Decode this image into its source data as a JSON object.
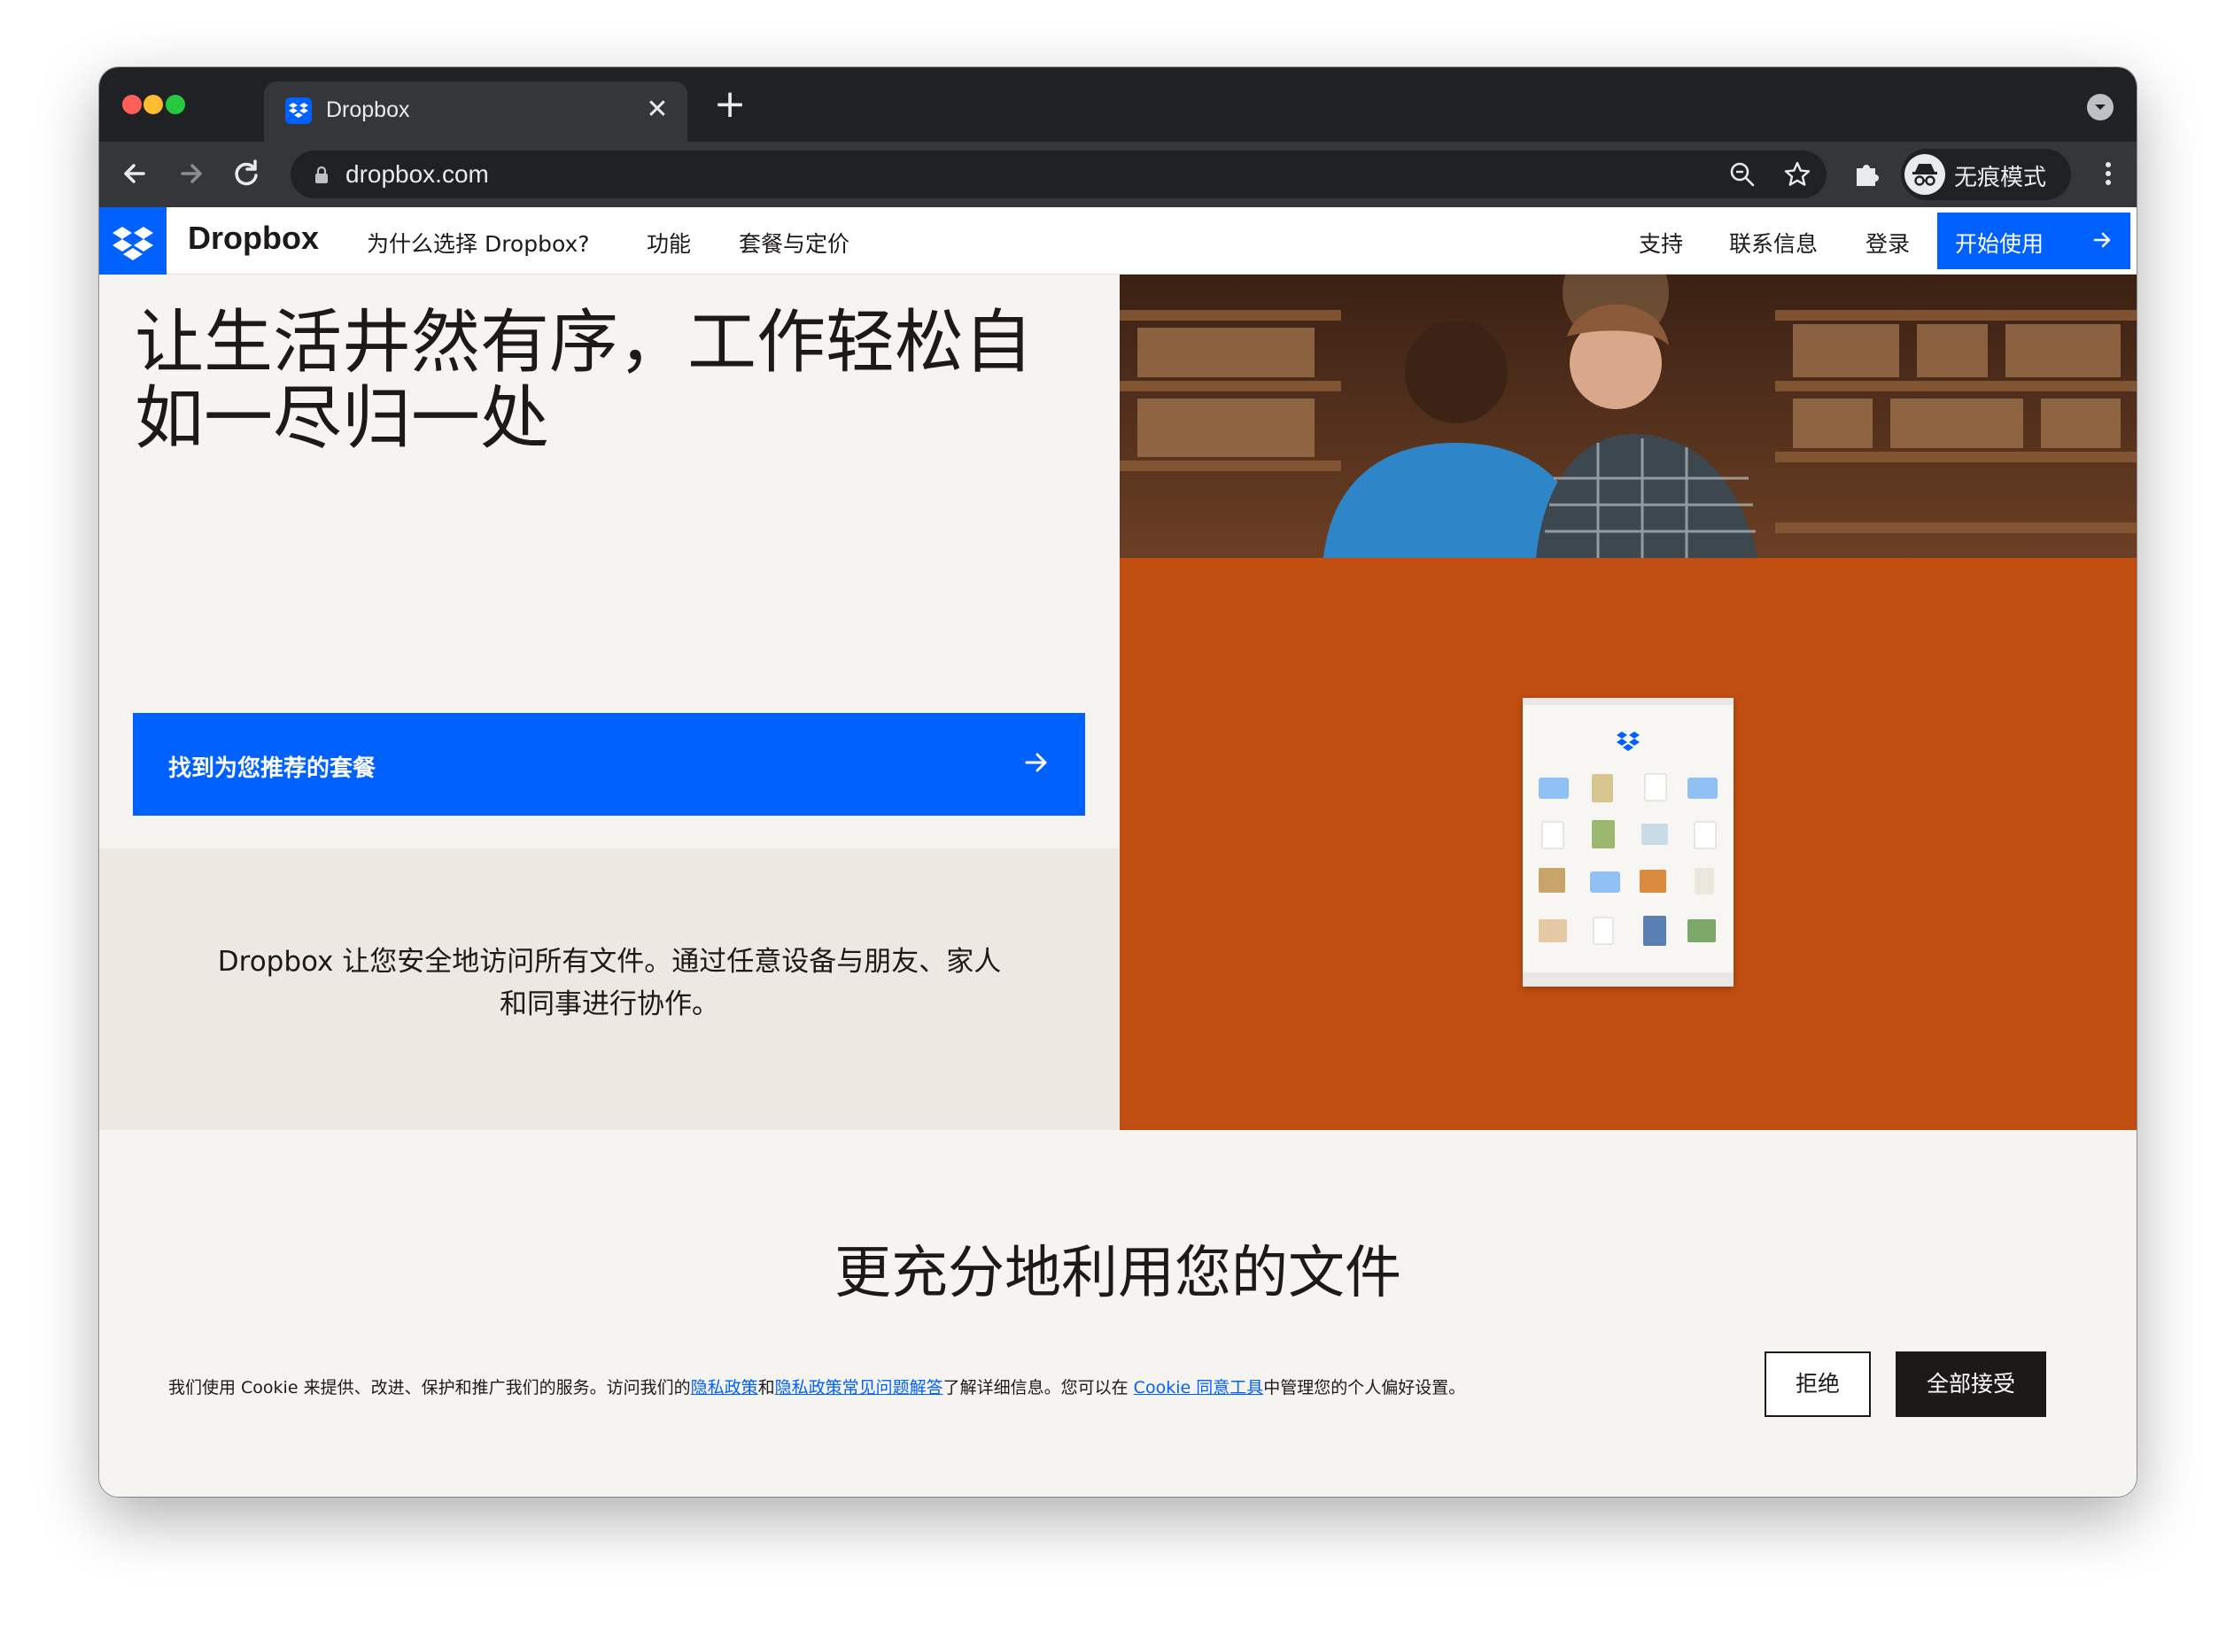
{
  "browser": {
    "tab_title": "Dropbox",
    "tab_close": "✕",
    "new_tab": "+",
    "url": "dropbox.com",
    "profile_label": "无痕模式"
  },
  "nav": {
    "brand": "Dropbox",
    "links": [
      "为什么选择 Dropbox?",
      "功能",
      "套餐与定价"
    ],
    "right_links": [
      "支持",
      "联系信息",
      "登录"
    ],
    "cta": "开始使用"
  },
  "hero": {
    "title": "让生活井然有序，工作轻松自如一尽归一处",
    "cta": "找到为您推荐的套餐",
    "subtitle": "Dropbox 让您安全地访问所有文件。通过任意设备与朋友、家人和同事进行协作。"
  },
  "section": {
    "heading": "更充分地利用您的文件"
  },
  "cookie": {
    "text_1": "我们使用 Cookie 来提供、改进、保护和推广我们的服务。访问我们的",
    "link_1": "隐私政策",
    "text_2": "和",
    "link_2": "隐私政策常见问题解答",
    "text_3": "了解详细信息。您可以在 ",
    "link_3": "Cookie 同意工具",
    "text_4": "中管理您的个人偏好设置。",
    "reject": "拒绝",
    "accept": "全部接受"
  },
  "colors": {
    "brand_blue": "#0061fe",
    "hero_orange": "#c04e10",
    "text_dark": "#1e1919",
    "chrome_dark": "#202124"
  }
}
